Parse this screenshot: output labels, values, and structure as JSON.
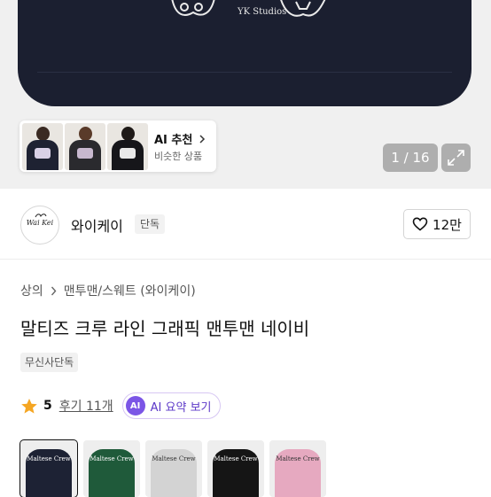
{
  "hero": {
    "print_text": "YK Studios",
    "ai_card": {
      "title": "AI 추천",
      "subtitle": "비슷한 상품"
    },
    "counter": "1 / 16"
  },
  "brand": {
    "logo_text": "Wai Kei",
    "name": "와이케이",
    "tag": "단독",
    "likes": "12만"
  },
  "product": {
    "breadcrumb": [
      "상의",
      "맨투맨/스웨트 (와이케이)"
    ],
    "title": "말티즈 크루 라인 그래픽 맨투맨 네이비",
    "exclusive_badge": "무신사단독",
    "rating": "5",
    "reviews": "후기 11개",
    "ai_summary": {
      "badge": "AI",
      "label": "AI 요약 보기"
    }
  },
  "swatches": [
    {
      "name": "navy",
      "color": "#1d2234",
      "text_color": "#ffffff",
      "text": "Maltese Crew",
      "selected": true
    },
    {
      "name": "green",
      "color": "#1f5a3a",
      "text_color": "#ffffff",
      "text": "Maltese Crew",
      "selected": false
    },
    {
      "name": "gray",
      "color": "#d3d3d3",
      "text_color": "#333333",
      "text": "Maltese Crew",
      "selected": false
    },
    {
      "name": "black",
      "color": "#151515",
      "text_color": "#ffffff",
      "text": "Maltese Crew",
      "selected": false
    },
    {
      "name": "pink",
      "color": "#e6a9c0",
      "text_color": "#333333",
      "text": "Maltese Crew",
      "selected": false
    }
  ],
  "colors": {
    "accent_purple": "#7b55e6",
    "star": "#f5a623",
    "garment_navy": "#1b1f30"
  }
}
